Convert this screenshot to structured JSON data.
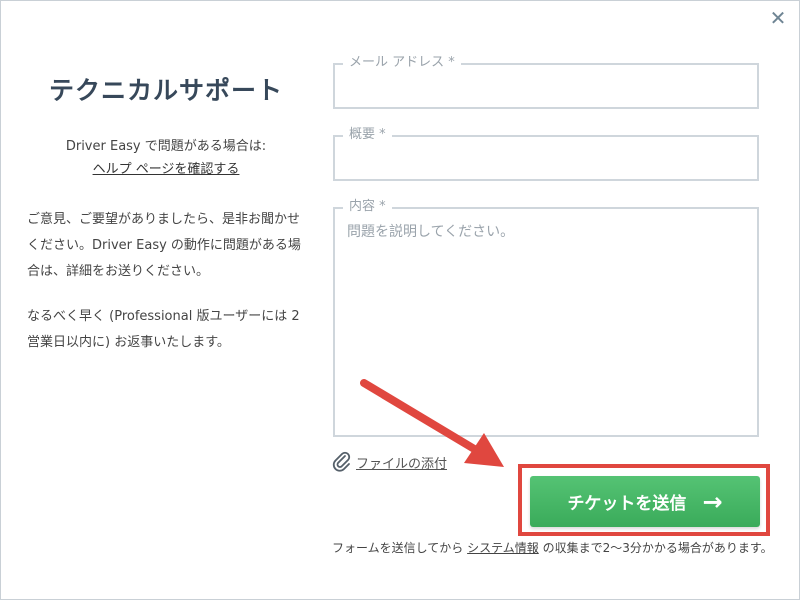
{
  "window": {
    "close_symbol": "✕"
  },
  "left": {
    "title": "テクニカルサポート",
    "intro": "Driver Easy で問題がある場合は:",
    "help_link": "ヘルプ ページを確認する",
    "description": "ご意見、ご要望がありましたら、是非お聞かせください。Driver Easy の動作に問題がある場合は、詳細をお送りください。",
    "response_note": "なるべく早く (Professional 版ユーザーには 2 営業日以内に) お返事いたします。"
  },
  "form": {
    "email_label": "メール アドレス *",
    "email_value": "",
    "subject_label": "概要 *",
    "subject_value": "",
    "content_label": "内容 *",
    "content_placeholder": "問題を説明してください。",
    "content_value": ""
  },
  "attach": {
    "label": "ファイルの添付",
    "icon": "paperclip-icon"
  },
  "submit": {
    "label": "チケットを送信",
    "arrow": "→"
  },
  "footer": {
    "prefix": "フォームを送信してから ",
    "system_info_link": "システム情報",
    "suffix": " の収集まで2～3分かかる場合があります。"
  },
  "colors": {
    "title": "#37485a",
    "button_green": "#3aab5a",
    "highlight_red": "#e0473f",
    "border": "#cfd6dc"
  }
}
